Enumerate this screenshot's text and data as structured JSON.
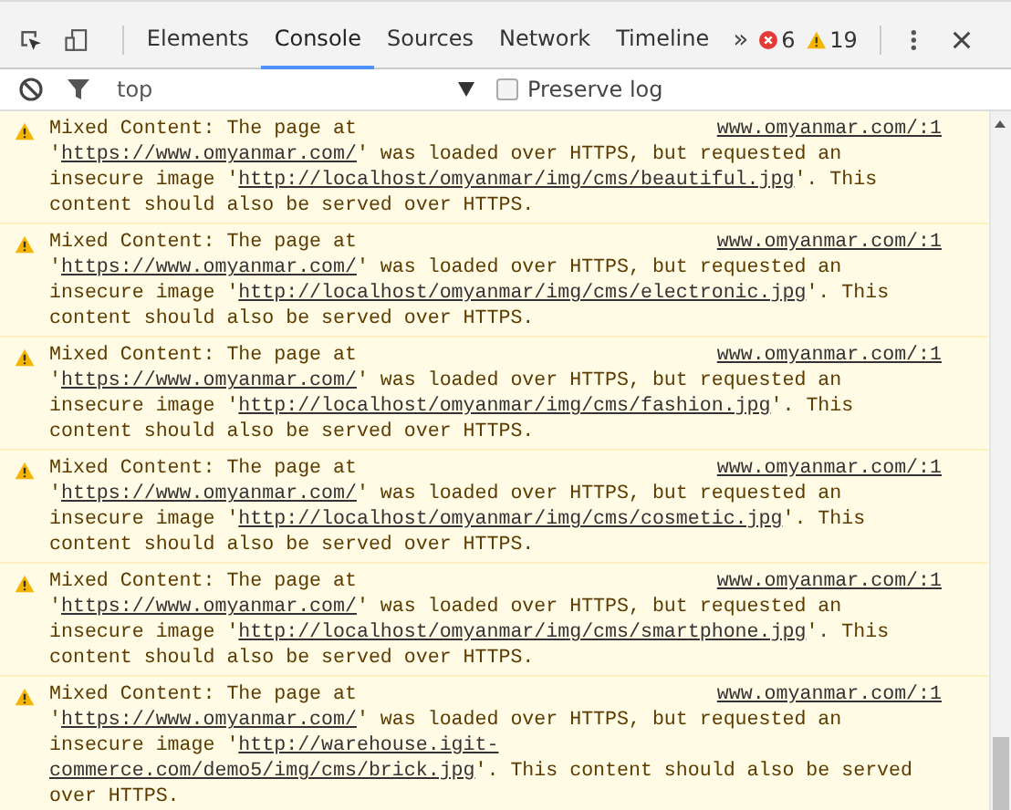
{
  "tabs": [
    {
      "label": "Elements",
      "selected": false
    },
    {
      "label": "Console",
      "selected": true
    },
    {
      "label": "Sources",
      "selected": false
    },
    {
      "label": "Network",
      "selected": false
    },
    {
      "label": "Timeline",
      "selected": false
    }
  ],
  "overflow": "»",
  "error_count": "6",
  "warning_count": "19",
  "context": "top",
  "preserve_log": {
    "label": "Preserve log",
    "checked": false
  },
  "messages": [
    {
      "kind": "warning",
      "source": "www.omyanmar.com/:1",
      "lines": [
        [
          {
            "kind": "text",
            "text": "Mixed Content: The page at"
          }
        ],
        [
          {
            "kind": "text",
            "text": "'"
          },
          {
            "kind": "link",
            "text": "https://www.omyanmar.com/"
          },
          {
            "kind": "text",
            "text": "' was loaded over HTTPS, but requested an"
          }
        ],
        [
          {
            "kind": "text",
            "text": "insecure image '"
          },
          {
            "kind": "link",
            "text": "http://localhost/omyanmar/img/cms/beautiful.jpg"
          },
          {
            "kind": "text",
            "text": "'. This"
          }
        ],
        [
          {
            "kind": "text",
            "text": "content should also be served over HTTPS."
          }
        ]
      ]
    },
    {
      "kind": "warning",
      "source": "www.omyanmar.com/:1",
      "lines": [
        [
          {
            "kind": "text",
            "text": "Mixed Content: The page at"
          }
        ],
        [
          {
            "kind": "text",
            "text": "'"
          },
          {
            "kind": "link",
            "text": "https://www.omyanmar.com/"
          },
          {
            "kind": "text",
            "text": "' was loaded over HTTPS, but requested an"
          }
        ],
        [
          {
            "kind": "text",
            "text": "insecure image '"
          },
          {
            "kind": "link",
            "text": "http://localhost/omyanmar/img/cms/electronic.jpg"
          },
          {
            "kind": "text",
            "text": "'. This"
          }
        ],
        [
          {
            "kind": "text",
            "text": "content should also be served over HTTPS."
          }
        ]
      ]
    },
    {
      "kind": "warning",
      "source": "www.omyanmar.com/:1",
      "lines": [
        [
          {
            "kind": "text",
            "text": "Mixed Content: The page at"
          }
        ],
        [
          {
            "kind": "text",
            "text": "'"
          },
          {
            "kind": "link",
            "text": "https://www.omyanmar.com/"
          },
          {
            "kind": "text",
            "text": "' was loaded over HTTPS, but requested an"
          }
        ],
        [
          {
            "kind": "text",
            "text": "insecure image '"
          },
          {
            "kind": "link",
            "text": "http://localhost/omyanmar/img/cms/fashion.jpg"
          },
          {
            "kind": "text",
            "text": "'. This"
          }
        ],
        [
          {
            "kind": "text",
            "text": "content should also be served over HTTPS."
          }
        ]
      ]
    },
    {
      "kind": "warning",
      "source": "www.omyanmar.com/:1",
      "lines": [
        [
          {
            "kind": "text",
            "text": "Mixed Content: The page at"
          }
        ],
        [
          {
            "kind": "text",
            "text": "'"
          },
          {
            "kind": "link",
            "text": "https://www.omyanmar.com/"
          },
          {
            "kind": "text",
            "text": "' was loaded over HTTPS, but requested an"
          }
        ],
        [
          {
            "kind": "text",
            "text": "insecure image '"
          },
          {
            "kind": "link",
            "text": "http://localhost/omyanmar/img/cms/cosmetic.jpg"
          },
          {
            "kind": "text",
            "text": "'. This"
          }
        ],
        [
          {
            "kind": "text",
            "text": "content should also be served over HTTPS."
          }
        ]
      ]
    },
    {
      "kind": "warning",
      "source": "www.omyanmar.com/:1",
      "lines": [
        [
          {
            "kind": "text",
            "text": "Mixed Content: The page at"
          }
        ],
        [
          {
            "kind": "text",
            "text": "'"
          },
          {
            "kind": "link",
            "text": "https://www.omyanmar.com/"
          },
          {
            "kind": "text",
            "text": "' was loaded over HTTPS, but requested an"
          }
        ],
        [
          {
            "kind": "text",
            "text": "insecure image '"
          },
          {
            "kind": "link",
            "text": "http://localhost/omyanmar/img/cms/smartphone.jpg"
          },
          {
            "kind": "text",
            "text": "'. This"
          }
        ],
        [
          {
            "kind": "text",
            "text": "content should also be served over HTTPS."
          }
        ]
      ]
    },
    {
      "kind": "warning",
      "source": "www.omyanmar.com/:1",
      "lines": [
        [
          {
            "kind": "text",
            "text": "Mixed Content: The page at"
          }
        ],
        [
          {
            "kind": "text",
            "text": "'"
          },
          {
            "kind": "link",
            "text": "https://www.omyanmar.com/"
          },
          {
            "kind": "text",
            "text": "' was loaded over HTTPS, but requested an"
          }
        ],
        [
          {
            "kind": "text",
            "text": "insecure image '"
          },
          {
            "kind": "link",
            "text": "http://warehouse.igit-"
          }
        ],
        [
          {
            "kind": "link",
            "text": "commerce.com/demo5/img/cms/brick.jpg"
          },
          {
            "kind": "text",
            "text": "'. This content should also be served"
          }
        ],
        [
          {
            "kind": "text",
            "text": "over HTTPS."
          }
        ]
      ]
    }
  ]
}
